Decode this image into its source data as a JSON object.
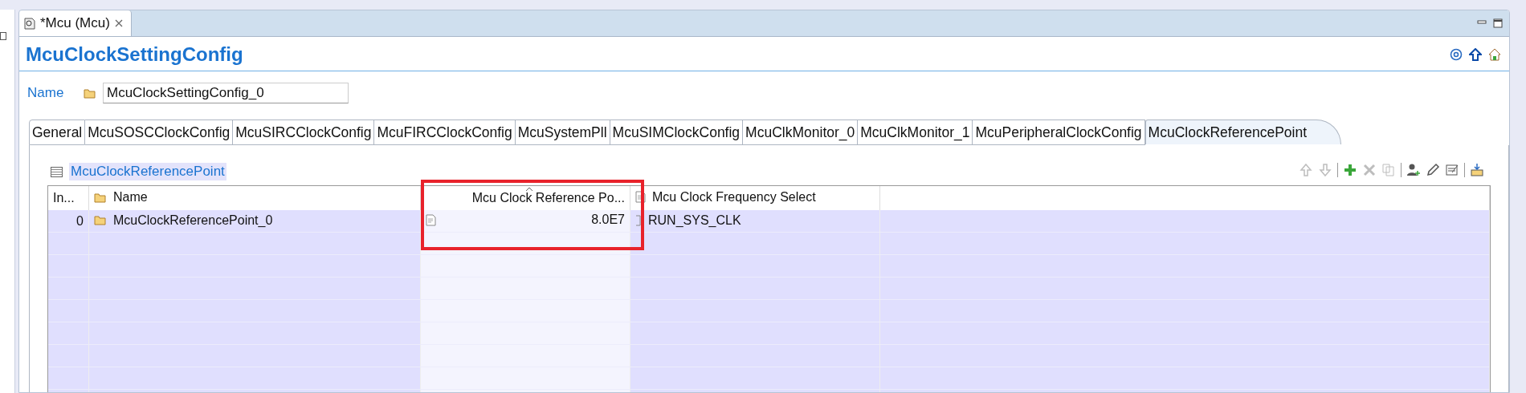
{
  "editor_tab": {
    "label": "*Mcu (Mcu)"
  },
  "title": "McuClockSettingConfig",
  "name_field": {
    "label": "Name",
    "value": "McuClockSettingConfig_0"
  },
  "config_tabs": [
    {
      "label": "General",
      "selected": false
    },
    {
      "label": "McuSOSCClockConfig",
      "selected": false
    },
    {
      "label": "McuSIRCClockConfig",
      "selected": false
    },
    {
      "label": "McuFIRCClockConfig",
      "selected": false
    },
    {
      "label": "McuSystemPll",
      "selected": false
    },
    {
      "label": "McuSIMClockConfig",
      "selected": false
    },
    {
      "label": "McuClkMonitor_0",
      "selected": false
    },
    {
      "label": "McuClkMonitor_1",
      "selected": false
    },
    {
      "label": "McuPeripheralClockConfig",
      "selected": false
    },
    {
      "label": "McuClockReferencePoint",
      "selected": true
    }
  ],
  "section": {
    "title": "McuClockReferencePoint"
  },
  "toolbar": [
    {
      "kind": "up",
      "disabled": true
    },
    {
      "kind": "down",
      "disabled": true
    },
    {
      "kind": "separator"
    },
    {
      "kind": "add",
      "disabled": false
    },
    {
      "kind": "delete",
      "disabled": true
    },
    {
      "kind": "copy",
      "disabled": true
    },
    {
      "kind": "separator"
    },
    {
      "kind": "user",
      "disabled": false
    },
    {
      "kind": "pencil",
      "disabled": false
    },
    {
      "kind": "edit",
      "disabled": false
    },
    {
      "kind": "separator"
    },
    {
      "kind": "import",
      "disabled": false
    }
  ],
  "table": {
    "columns": [
      "In...",
      "Name",
      "Mcu Clock Reference Po...",
      "Mcu Clock Frequency Select"
    ],
    "rows": [
      {
        "index": "0",
        "name": "McuClockReferencePoint_0",
        "reference_point": "8.0E7",
        "frequency_select": "RUN_SYS_CLK"
      }
    ]
  }
}
